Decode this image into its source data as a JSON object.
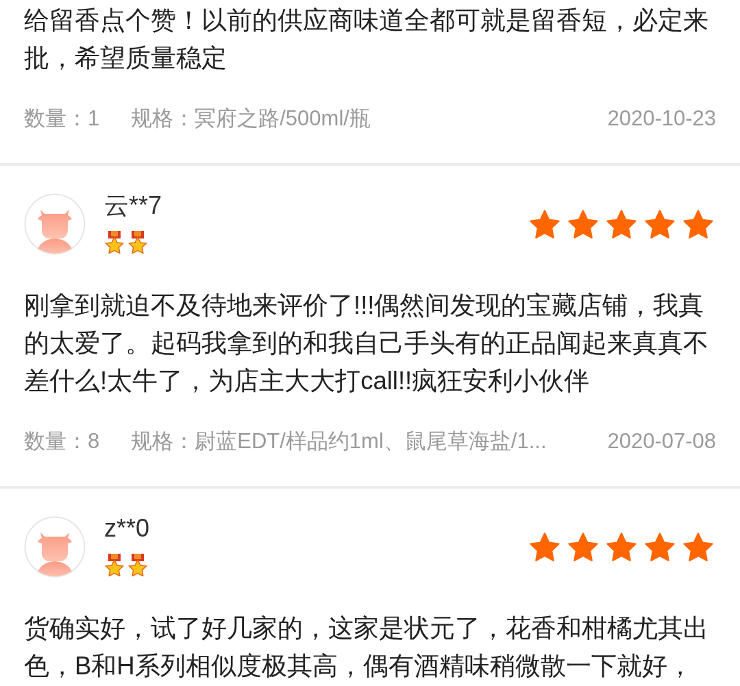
{
  "reviews": [
    {
      "text": "给留香点个赞！以前的供应商味道全都可就是留香短，必定来批，希望质量稳定",
      "quantity": "数量：1",
      "spec": "规格：冥府之路/500ml/瓶",
      "date": "2020-10-23"
    },
    {
      "user": "云**7",
      "stars": 5,
      "text": "刚拿到就迫不及待地来评价了!!!偶然间发现的宝藏店铺，我真的太爱了。起码我拿到的和我自己手头有的正品闻起来真真不差什么!太牛了，为店主大大打call!!疯狂安利小伙伴",
      "quantity": "数量：8",
      "spec": "规格：尉蓝EDT/样品约1ml、鼠尾草海盐/1...",
      "date": "2020-07-08"
    },
    {
      "user": "z**0",
      "stars": 5,
      "text": "货确实好，试了好几家的，这家是状元了，花香和柑橘尤其出色，B和H系列相似度极其高，偶有酒精味稍微散一下就好，"
    }
  ]
}
